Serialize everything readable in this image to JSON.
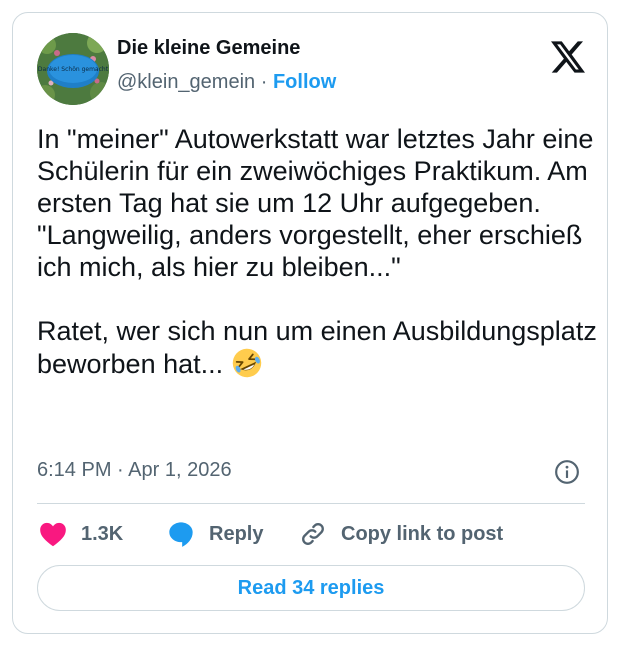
{
  "author": {
    "name": "Die kleine Gemeine",
    "handle": "@klein_gemein",
    "separator": "·",
    "follow_label": "Follow",
    "avatar_text": "Danke! Schön gemacht"
  },
  "tweet": {
    "paragraphs": [
      "In \"meiner\" Autowerkstatt war letztes Jahr eine Schülerin für ein zweiwöchiges Praktikum. Am ersten Tag hat sie um 12 Uhr aufgegeben. \"Langweilig, anders vorgestellt, eher erschieß ich mich, als hier zu bleiben...\"",
      "Ratet, wer sich nun um einen Ausbildungsplatz beworben hat..."
    ],
    "emoji": "rolling-on-the-floor-laughing",
    "timestamp": "6:14 PM · Apr 1, 2026"
  },
  "actions": {
    "like_count": "1.3K",
    "reply_label": "Reply",
    "copy_label": "Copy link to post",
    "read_replies_label": "Read 34 replies"
  },
  "icons": [
    "x-logo-icon",
    "info-icon",
    "heart-icon",
    "reply-bubble-icon",
    "link-icon"
  ],
  "colors": {
    "accent": "#1d9bf0",
    "heart": "#f91880",
    "text": "#0f1419",
    "secondary": "#536471",
    "border": "#cfd9de"
  }
}
